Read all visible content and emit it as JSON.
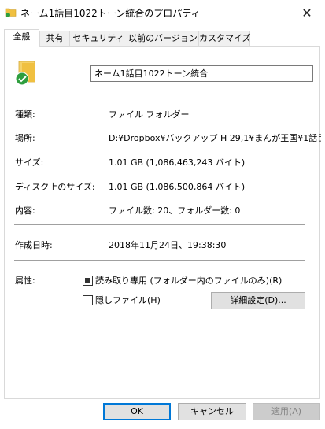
{
  "window": {
    "title": "ネーム1話目1022トーン統合のプロパティ",
    "close_glyph": "✕"
  },
  "tabs": [
    {
      "label": "全般",
      "active": true
    },
    {
      "label": "共有"
    },
    {
      "label": "セキュリティ"
    },
    {
      "label": "以前のバージョン"
    },
    {
      "label": "カスタマイズ"
    }
  ],
  "general": {
    "folder_name": "ネーム1話目1022トーン統合",
    "type_label": "種類:",
    "type_value": "ファイル フォルダー",
    "location_label": "場所:",
    "location_value": "D:¥Dropbox¥バックアップ H 29,1¥まんが王国¥1話目¥ネ",
    "size_label": "サイズ:",
    "size_value": "1.01 GB (1,086,463,243 バイト)",
    "disk_size_label": "ディスク上のサイズ:",
    "disk_size_value": "1.01 GB (1,086,500,864 バイト)",
    "contents_label": "内容:",
    "contents_value": "ファイル数: 20、フォルダー数: 0",
    "created_label": "作成日時:",
    "created_value": "2018年11月24日、19:38:30",
    "attributes_label": "属性:",
    "readonly_label": "読み取り専用 (フォルダー内のファイルのみ)(R)",
    "hidden_label": "隠しファイル(H)",
    "advanced_button": "詳細設定(D)..."
  },
  "footer": {
    "ok": "OK",
    "cancel": "キャンセル",
    "apply": "適用(A)"
  },
  "colors": {
    "folder": "#f0c040",
    "check_badge": "#2e9e3e",
    "accent": "#0078d7"
  }
}
